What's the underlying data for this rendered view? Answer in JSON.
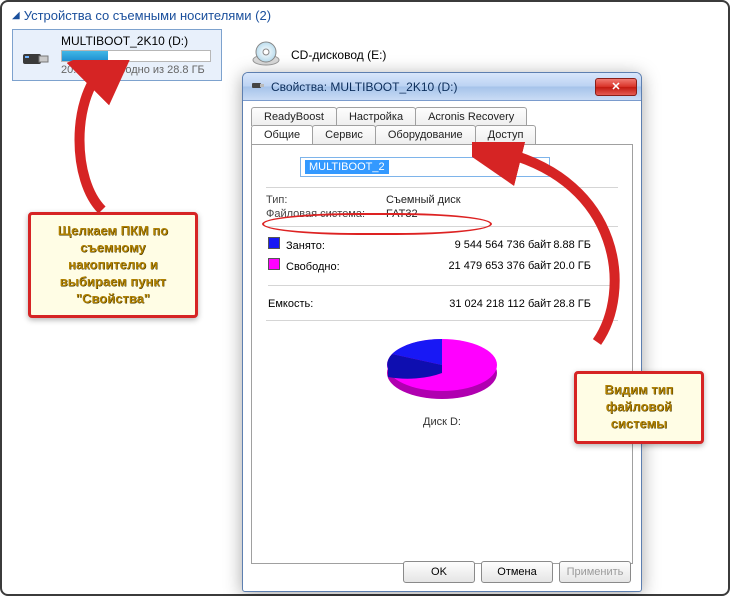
{
  "explorer": {
    "section_title": "Устройства со съемными носителями (2)",
    "usb": {
      "name": "MULTIBOOT_2K10 (D:)",
      "subtext": "20.0 ГБ свободно из 28.8 ГБ"
    },
    "cd": {
      "name": "CD-дисковод (E:)"
    }
  },
  "dialog": {
    "title": "Свойства: MULTIBOOT_2K10 (D:)",
    "tabs": {
      "row1": [
        "ReadyBoost",
        "Настройка",
        "Acronis Recovery"
      ],
      "row2": [
        "Общие",
        "Сервис",
        "Оборудование",
        "Доступ"
      ]
    },
    "name_field": "MULTIBOOT_2",
    "type_label": "Тип:",
    "type_value": "Съемный диск",
    "fs_label": "Файловая система:",
    "fs_value": "FAT32",
    "used_label": "Занято:",
    "used_bytes": "9 544 564 736 байт",
    "used_gb": "8.88 ГБ",
    "free_label": "Свободно:",
    "free_bytes": "21 479 653 376 байт",
    "free_gb": "20.0 ГБ",
    "cap_label": "Емкость:",
    "cap_bytes": "31 024 218 112 байт",
    "cap_gb": "28.8 ГБ",
    "disk_label": "Диск D:",
    "buttons": {
      "ok": "OK",
      "cancel": "Отмена",
      "apply": "Применить"
    }
  },
  "callouts": {
    "left": "Щелкаем ПКМ по съемному накопителю и выбираем пункт \"Свойства\"",
    "right": "Видим тип файловой системы"
  },
  "chart_data": {
    "type": "pie",
    "title": "Диск D:",
    "series": [
      {
        "name": "Занято",
        "value": 9544564736,
        "display_gb": "8.88 ГБ",
        "color": "#1818f5"
      },
      {
        "name": "Свободно",
        "value": 21479653376,
        "display_gb": "20.0 ГБ",
        "color": "#ff00ff"
      }
    ],
    "total": {
      "name": "Емкость",
      "value": 31024218112,
      "display_gb": "28.8 ГБ"
    }
  }
}
